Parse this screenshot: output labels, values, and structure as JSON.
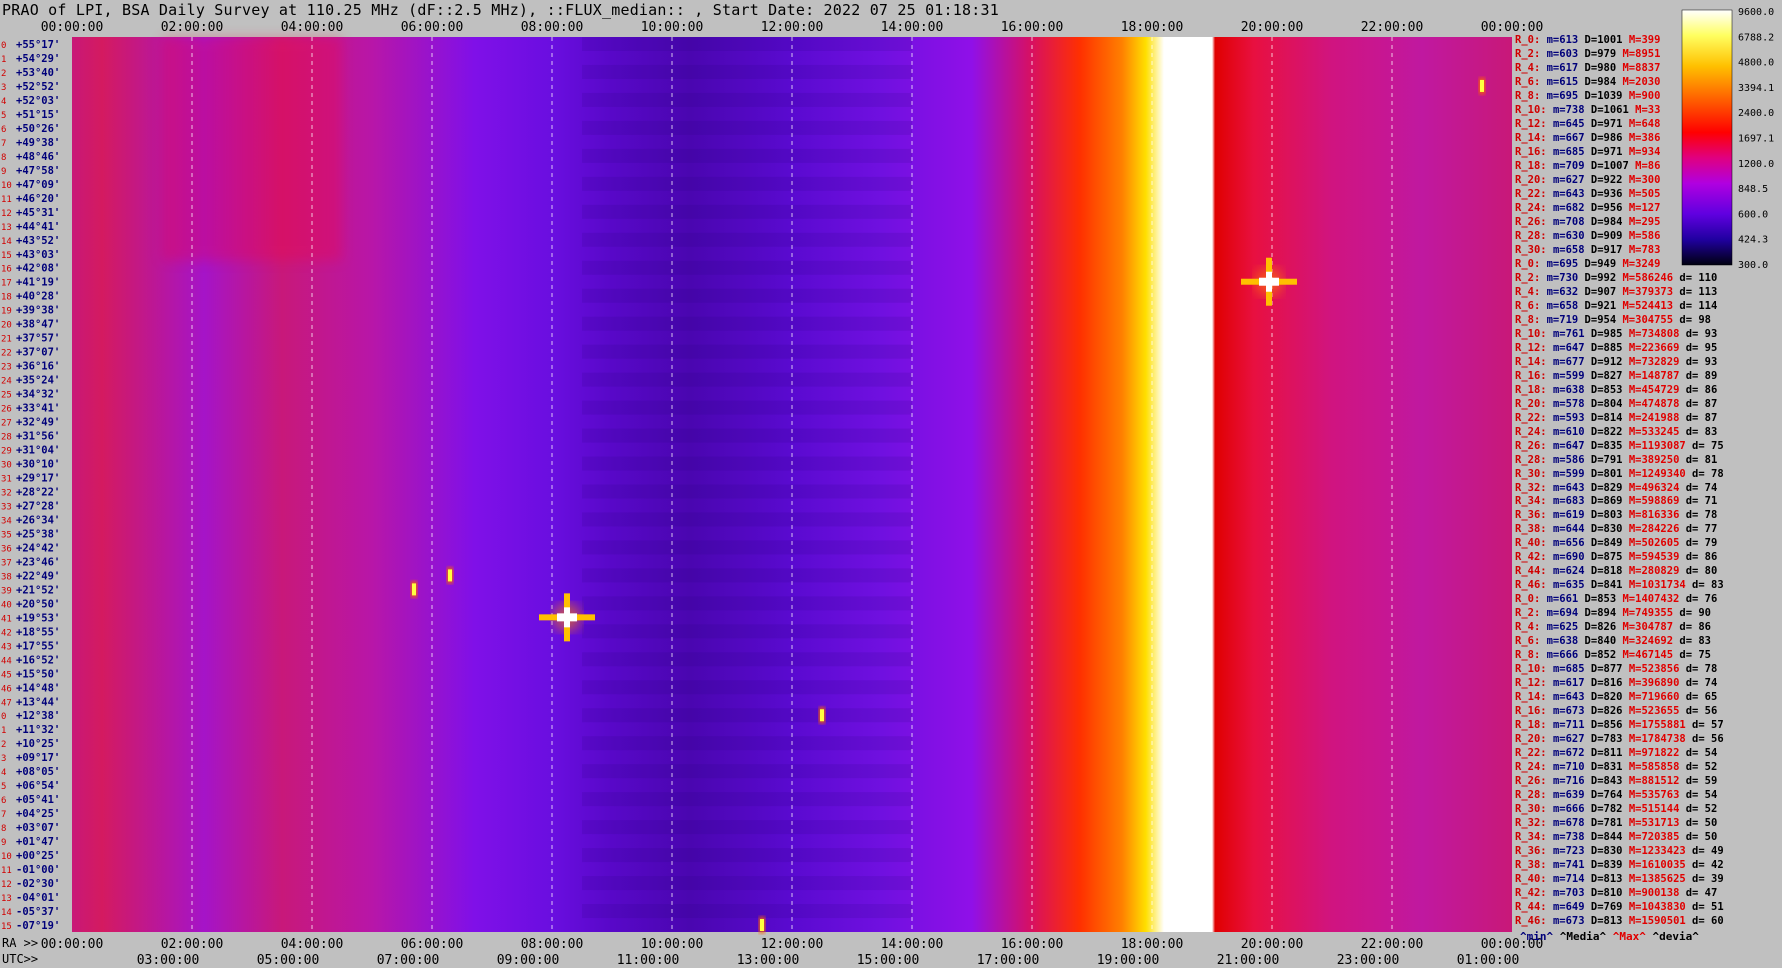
{
  "title": "PRAO of LPI, BSA Daily Survey at 110.25 MHz (dF::2.5 MHz), ::FLUX_median:: , Start Date: 2022 07 25 01:18:31",
  "ra_label": "RA >>",
  "utc_label": "UTC>>",
  "chart_data": {
    "type": "heatmap",
    "title": "PRAO of LPI, BSA Daily Survey at 110.25 MHz (dF::2.5 MHz), ::FLUX_median:: , Start Date: 2022 07 25 01:18:31",
    "x_top_ticks": [
      "00:00:00",
      "02:00:00",
      "04:00:00",
      "06:00:00",
      "08:00:00",
      "10:00:00",
      "12:00:00",
      "14:00:00",
      "16:00:00",
      "18:00:00",
      "20:00:00",
      "22:00:00",
      "00:00:00"
    ],
    "x_bottom_ra_ticks": [
      "00:00:00",
      "02:00:00",
      "04:00:00",
      "06:00:00",
      "08:00:00",
      "10:00:00",
      "12:00:00",
      "14:00:00",
      "16:00:00",
      "18:00:00",
      "20:00:00",
      "22:00:00",
      "00:00:00"
    ],
    "x_bottom_utc_ticks": [
      "03:00:00",
      "05:00:00",
      "07:00:00",
      "09:00:00",
      "11:00:00",
      "13:00:00",
      "15:00:00",
      "17:00:00",
      "19:00:00",
      "21:00:00",
      "23:00:00",
      "01:00:00"
    ],
    "y_dec_labels": [
      "+55°17'",
      "+54°29'",
      "+53°40'",
      "+52°52'",
      "+52°03'",
      "+51°15'",
      "+50°26'",
      "+49°38'",
      "+48°46'",
      "+47°58'",
      "+47°09'",
      "+46°20'",
      "+45°31'",
      "+44°41'",
      "+43°52'",
      "+43°03'",
      "+42°08'",
      "+41°19'",
      "+40°28'",
      "+39°38'",
      "+38°47'",
      "+37°57'",
      "+37°07'",
      "+36°16'",
      "+35°24'",
      "+34°32'",
      "+33°41'",
      "+32°49'",
      "+31°56'",
      "+31°04'",
      "+30°10'",
      "+29°17'",
      "+28°22'",
      "+27°28'",
      "+26°34'",
      "+25°38'",
      "+24°42'",
      "+23°46'",
      "+22°49'",
      "+21°52'",
      "+20°50'",
      "+19°53'",
      "+18°55'",
      "+17°55'",
      "+16°52'",
      "+15°50'",
      "+14°48'",
      "+13°44'",
      "+12°38'",
      "+11°32'",
      "+10°25'",
      "+09°17'",
      "+08°05'",
      "+06°54'",
      "+05°41'",
      "+04°25'",
      "+03°07'",
      "+01°47'",
      "+00°25'",
      "-01°00'",
      "-02°30'",
      "-04°01'",
      "-05°37'",
      "-07°19'"
    ],
    "colorbar": {
      "labels": [
        "9600.0",
        "6788.2",
        "4800.0",
        "3394.1",
        "2400.0",
        "1697.1",
        "1200.0",
        "848.5",
        "600.0",
        "424.3",
        "300.0"
      ],
      "colors": [
        "#ffffff",
        "#ffff40",
        "#ffc000",
        "#ff6000",
        "#ff0000",
        "#e00080",
        "#b000e0",
        "#6000e0",
        "#2000a0",
        "#000020"
      ]
    },
    "colors": {
      "background_violet": "#7a10e8",
      "background_red": "#e01050",
      "band_white": "#ffffff",
      "band_yellow": "#ffe000",
      "band_orange": "#ff7000",
      "dark_lane": "#4000b0"
    },
    "bright_band_ra_hours": {
      "start": 16.0,
      "peak_start": 18.2,
      "peak_end": 19.0,
      "end": 19.7
    },
    "sources": [
      {
        "ra": 8.25,
        "row": 41,
        "peak": "white"
      },
      {
        "ra": 19.95,
        "row": 17,
        "peak": "white"
      },
      {
        "ra": 5.7,
        "row": 39,
        "peak": "yellow"
      },
      {
        "ra": 6.3,
        "row": 38,
        "peak": "yellow"
      },
      {
        "ra": 12.5,
        "row": 48,
        "peak": "yellow"
      },
      {
        "ra": 11.5,
        "row": 63,
        "peak": "yellow"
      },
      {
        "ra": 23.5,
        "row": 3,
        "peak": "yellow"
      }
    ],
    "stats_footer": {
      "min": "^min^",
      "median": "^Media^",
      "max": "^Max^",
      "dev": "^devia^"
    },
    "stats_rows": [
      {
        "r": "R_0:",
        "m": "m=613",
        "D": "D=1001",
        "M": "M=399",
        "d": ""
      },
      {
        "r": "R_2:",
        "m": "m=603",
        "D": "D=979",
        "M": "M=8951",
        "d": ""
      },
      {
        "r": "R_4:",
        "m": "m=617",
        "D": "D=980",
        "M": "M=8837",
        "d": ""
      },
      {
        "r": "R_6:",
        "m": "m=615",
        "D": "D=984",
        "M": "M=2030",
        "d": ""
      },
      {
        "r": "R_8:",
        "m": "m=695",
        "D": "D=1039",
        "M": "M=900",
        "d": ""
      },
      {
        "r": "R_10:",
        "m": "m=738",
        "D": "D=1061",
        "M": "M=33",
        "d": ""
      },
      {
        "r": "R_12:",
        "m": "m=645",
        "D": "D=971",
        "M": "M=648",
        "d": ""
      },
      {
        "r": "R_14:",
        "m": "m=667",
        "D": "D=986",
        "M": "M=386",
        "d": ""
      },
      {
        "r": "R_16:",
        "m": "m=685",
        "D": "D=971",
        "M": "M=934",
        "d": ""
      },
      {
        "r": "R_18:",
        "m": "m=709",
        "D": "D=1007",
        "M": "M=86",
        "d": ""
      },
      {
        "r": "R_20:",
        "m": "m=627",
        "D": "D=922",
        "M": "M=300",
        "d": ""
      },
      {
        "r": "R_22:",
        "m": "m=643",
        "D": "D=936",
        "M": "M=505",
        "d": ""
      },
      {
        "r": "R_24:",
        "m": "m=682",
        "D": "D=956",
        "M": "M=127",
        "d": ""
      },
      {
        "r": "R_26:",
        "m": "m=708",
        "D": "D=984",
        "M": "M=295",
        "d": ""
      },
      {
        "r": "R_28:",
        "m": "m=630",
        "D": "D=909",
        "M": "M=586",
        "d": ""
      },
      {
        "r": "R_30:",
        "m": "m=658",
        "D": "D=917",
        "M": "M=783",
        "d": ""
      },
      {
        "r": "R_0:",
        "m": "m=695",
        "D": "D=949",
        "M": "M=3249",
        "d": ""
      },
      {
        "r": "R_2:",
        "m": "m=730",
        "D": "D=992",
        "M": "M=586246",
        "d": "d= 110"
      },
      {
        "r": "R_4:",
        "m": "m=632",
        "D": "D=907",
        "M": "M=379373",
        "d": "d= 113"
      },
      {
        "r": "R_6:",
        "m": "m=658",
        "D": "D=921",
        "M": "M=524413",
        "d": "d= 114"
      },
      {
        "r": "R_8:",
        "m": "m=719",
        "D": "D=954",
        "M": "M=304755",
        "d": "d= 98"
      },
      {
        "r": "R_10:",
        "m": "m=761",
        "D": "D=985",
        "M": "M=734808",
        "d": "d= 93"
      },
      {
        "r": "R_12:",
        "m": "m=647",
        "D": "D=885",
        "M": "M=223669",
        "d": "d= 95"
      },
      {
        "r": "R_14:",
        "m": "m=677",
        "D": "D=912",
        "M": "M=732829",
        "d": "d= 93"
      },
      {
        "r": "R_16:",
        "m": "m=599",
        "D": "D=827",
        "M": "M=148787",
        "d": "d= 89"
      },
      {
        "r": "R_18:",
        "m": "m=638",
        "D": "D=853",
        "M": "M=454729",
        "d": "d= 86"
      },
      {
        "r": "R_20:",
        "m": "m=578",
        "D": "D=804",
        "M": "M=474878",
        "d": "d= 87"
      },
      {
        "r": "R_22:",
        "m": "m=593",
        "D": "D=814",
        "M": "M=241988",
        "d": "d= 87"
      },
      {
        "r": "R_24:",
        "m": "m=610",
        "D": "D=822",
        "M": "M=533245",
        "d": "d= 83"
      },
      {
        "r": "R_26:",
        "m": "m=647",
        "D": "D=835",
        "M": "M=1193087",
        "d": "d= 75"
      },
      {
        "r": "R_28:",
        "m": "m=586",
        "D": "D=791",
        "M": "M=389250",
        "d": "d= 81"
      },
      {
        "r": "R_30:",
        "m": "m=599",
        "D": "D=801",
        "M": "M=1249340",
        "d": "d= 78"
      },
      {
        "r": "R_32:",
        "m": "m=643",
        "D": "D=829",
        "M": "M=496324",
        "d": "d= 74"
      },
      {
        "r": "R_34:",
        "m": "m=683",
        "D": "D=869",
        "M": "M=598869",
        "d": "d= 71"
      },
      {
        "r": "R_36:",
        "m": "m=619",
        "D": "D=803",
        "M": "M=816336",
        "d": "d= 78"
      },
      {
        "r": "R_38:",
        "m": "m=644",
        "D": "D=830",
        "M": "M=284226",
        "d": "d= 77"
      },
      {
        "r": "R_40:",
        "m": "m=656",
        "D": "D=849",
        "M": "M=502605",
        "d": "d= 79"
      },
      {
        "r": "R_42:",
        "m": "m=690",
        "D": "D=875",
        "M": "M=594539",
        "d": "d= 86"
      },
      {
        "r": "R_44:",
        "m": "m=624",
        "D": "D=818",
        "M": "M=280829",
        "d": "d= 80"
      },
      {
        "r": "R_46:",
        "m": "m=635",
        "D": "D=841",
        "M": "M=1031734",
        "d": "d= 83"
      },
      {
        "r": "R_0:",
        "m": "m=661",
        "D": "D=853",
        "M": "M=1407432",
        "d": "d= 76"
      },
      {
        "r": "R_2:",
        "m": "m=694",
        "D": "D=894",
        "M": "M=749355",
        "d": "d= 90"
      },
      {
        "r": "R_4:",
        "m": "m=625",
        "D": "D=826",
        "M": "M=304787",
        "d": "d= 86"
      },
      {
        "r": "R_6:",
        "m": "m=638",
        "D": "D=840",
        "M": "M=324692",
        "d": "d= 83"
      },
      {
        "r": "R_8:",
        "m": "m=666",
        "D": "D=852",
        "M": "M=467145",
        "d": "d= 75"
      },
      {
        "r": "R_10:",
        "m": "m=685",
        "D": "D=877",
        "M": "M=523856",
        "d": "d= 78"
      },
      {
        "r": "R_12:",
        "m": "m=617",
        "D": "D=816",
        "M": "M=396890",
        "d": "d= 74"
      },
      {
        "r": "R_14:",
        "m": "m=643",
        "D": "D=820",
        "M": "M=719660",
        "d": "d= 65"
      },
      {
        "r": "R_16:",
        "m": "m=673",
        "D": "D=826",
        "M": "M=523655",
        "d": "d= 56"
      },
      {
        "r": "R_18:",
        "m": "m=711",
        "D": "D=856",
        "M": "M=1755881",
        "d": "d= 57"
      },
      {
        "r": "R_20:",
        "m": "m=627",
        "D": "D=783",
        "M": "M=1784738",
        "d": "d= 56"
      },
      {
        "r": "R_22:",
        "m": "m=672",
        "D": "D=811",
        "M": "M=971822",
        "d": "d= 54"
      },
      {
        "r": "R_24:",
        "m": "m=710",
        "D": "D=831",
        "M": "M=585858",
        "d": "d= 52"
      },
      {
        "r": "R_26:",
        "m": "m=716",
        "D": "D=843",
        "M": "M=881512",
        "d": "d= 59"
      },
      {
        "r": "R_28:",
        "m": "m=639",
        "D": "D=764",
        "M": "M=535763",
        "d": "d= 54"
      },
      {
        "r": "R_30:",
        "m": "m=666",
        "D": "D=782",
        "M": "M=515144",
        "d": "d= 52"
      },
      {
        "r": "R_32:",
        "m": "m=678",
        "D": "D=781",
        "M": "M=531713",
        "d": "d= 50"
      },
      {
        "r": "R_34:",
        "m": "m=738",
        "D": "D=844",
        "M": "M=720385",
        "d": "d= 50"
      },
      {
        "r": "R_36:",
        "m": "m=723",
        "D": "D=830",
        "M": "M=1233423",
        "d": "d= 49"
      },
      {
        "r": "R_38:",
        "m": "m=741",
        "D": "D=839",
        "M": "M=1610035",
        "d": "d= 42"
      },
      {
        "r": "R_40:",
        "m": "m=714",
        "D": "D=813",
        "M": "M=1385625",
        "d": "d= 39"
      },
      {
        "r": "R_42:",
        "m": "m=703",
        "D": "D=810",
        "M": "M=900138",
        "d": "d= 47"
      },
      {
        "r": "R_44:",
        "m": "m=649",
        "D": "D=769",
        "M": "M=1043830",
        "d": "d= 51"
      },
      {
        "r": "R_46:",
        "m": "m=673",
        "D": "D=813",
        "M": "M=1590501",
        "d": "d= 60"
      }
    ]
  }
}
